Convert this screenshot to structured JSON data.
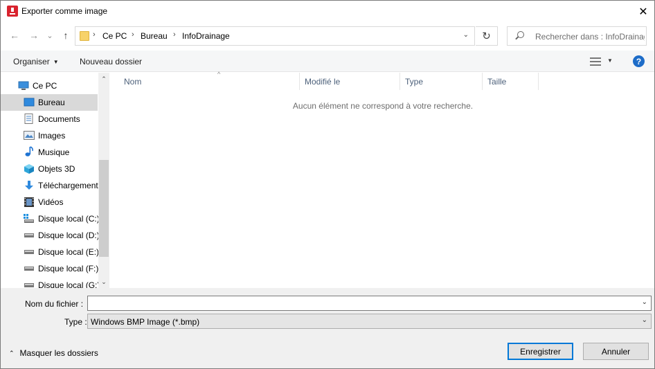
{
  "window": {
    "title": "Exporter comme image",
    "close_glyph": "✕"
  },
  "nav": {
    "back_glyph": "←",
    "forward_glyph": "→",
    "recent_glyph": "⌄",
    "up_glyph": "↑",
    "breadcrumb": [
      "Ce PC",
      "Bureau",
      "InfoDrainage"
    ],
    "breadcrumb_sep": "›",
    "dropdown_glyph": "⌄",
    "refresh_glyph": "↻",
    "search_placeholder": "Rechercher dans : InfoDrainage"
  },
  "commands": {
    "organize_label": "Organiser",
    "new_folder_label": "Nouveau dossier",
    "caret": "▼",
    "help_label": "?"
  },
  "sidebar": {
    "items": [
      {
        "label": "Ce PC",
        "icon": "computer-icon"
      },
      {
        "label": "Bureau",
        "icon": "desktop-icon",
        "selected": true
      },
      {
        "label": "Documents",
        "icon": "documents-icon"
      },
      {
        "label": "Images",
        "icon": "pictures-icon"
      },
      {
        "label": "Musique",
        "icon": "music-icon"
      },
      {
        "label": "Objets 3D",
        "icon": "3d-objects-icon"
      },
      {
        "label": "Téléchargements",
        "icon": "downloads-icon"
      },
      {
        "label": "Vidéos",
        "icon": "videos-icon"
      },
      {
        "label": "Disque local (C:)",
        "icon": "system-drive-icon"
      },
      {
        "label": "Disque local (D:)",
        "icon": "drive-icon"
      },
      {
        "label": "Disque local (E:)",
        "icon": "drive-icon"
      },
      {
        "label": "Disque local (F:)",
        "icon": "drive-icon"
      },
      {
        "label": "Disque local (G:)",
        "icon": "drive-icon"
      }
    ],
    "scroll_up": "⌃",
    "scroll_down": "⌄"
  },
  "list": {
    "columns": [
      "Nom",
      "Modifié le",
      "Type",
      "Taille"
    ],
    "sort_glyph": "^",
    "empty_message": "Aucun élément ne correspond à votre recherche."
  },
  "form": {
    "filename_label": "Nom du fichier :",
    "filename_value": "",
    "type_label": "Type :",
    "type_value": "Windows BMP Image (*.bmp)",
    "dropdown_glyph": "⌄"
  },
  "footer": {
    "hide_folders_label": "Masquer les dossiers",
    "hide_folders_glyph": "⌃",
    "save_label": "Enregistrer",
    "cancel_label": "Annuler"
  }
}
